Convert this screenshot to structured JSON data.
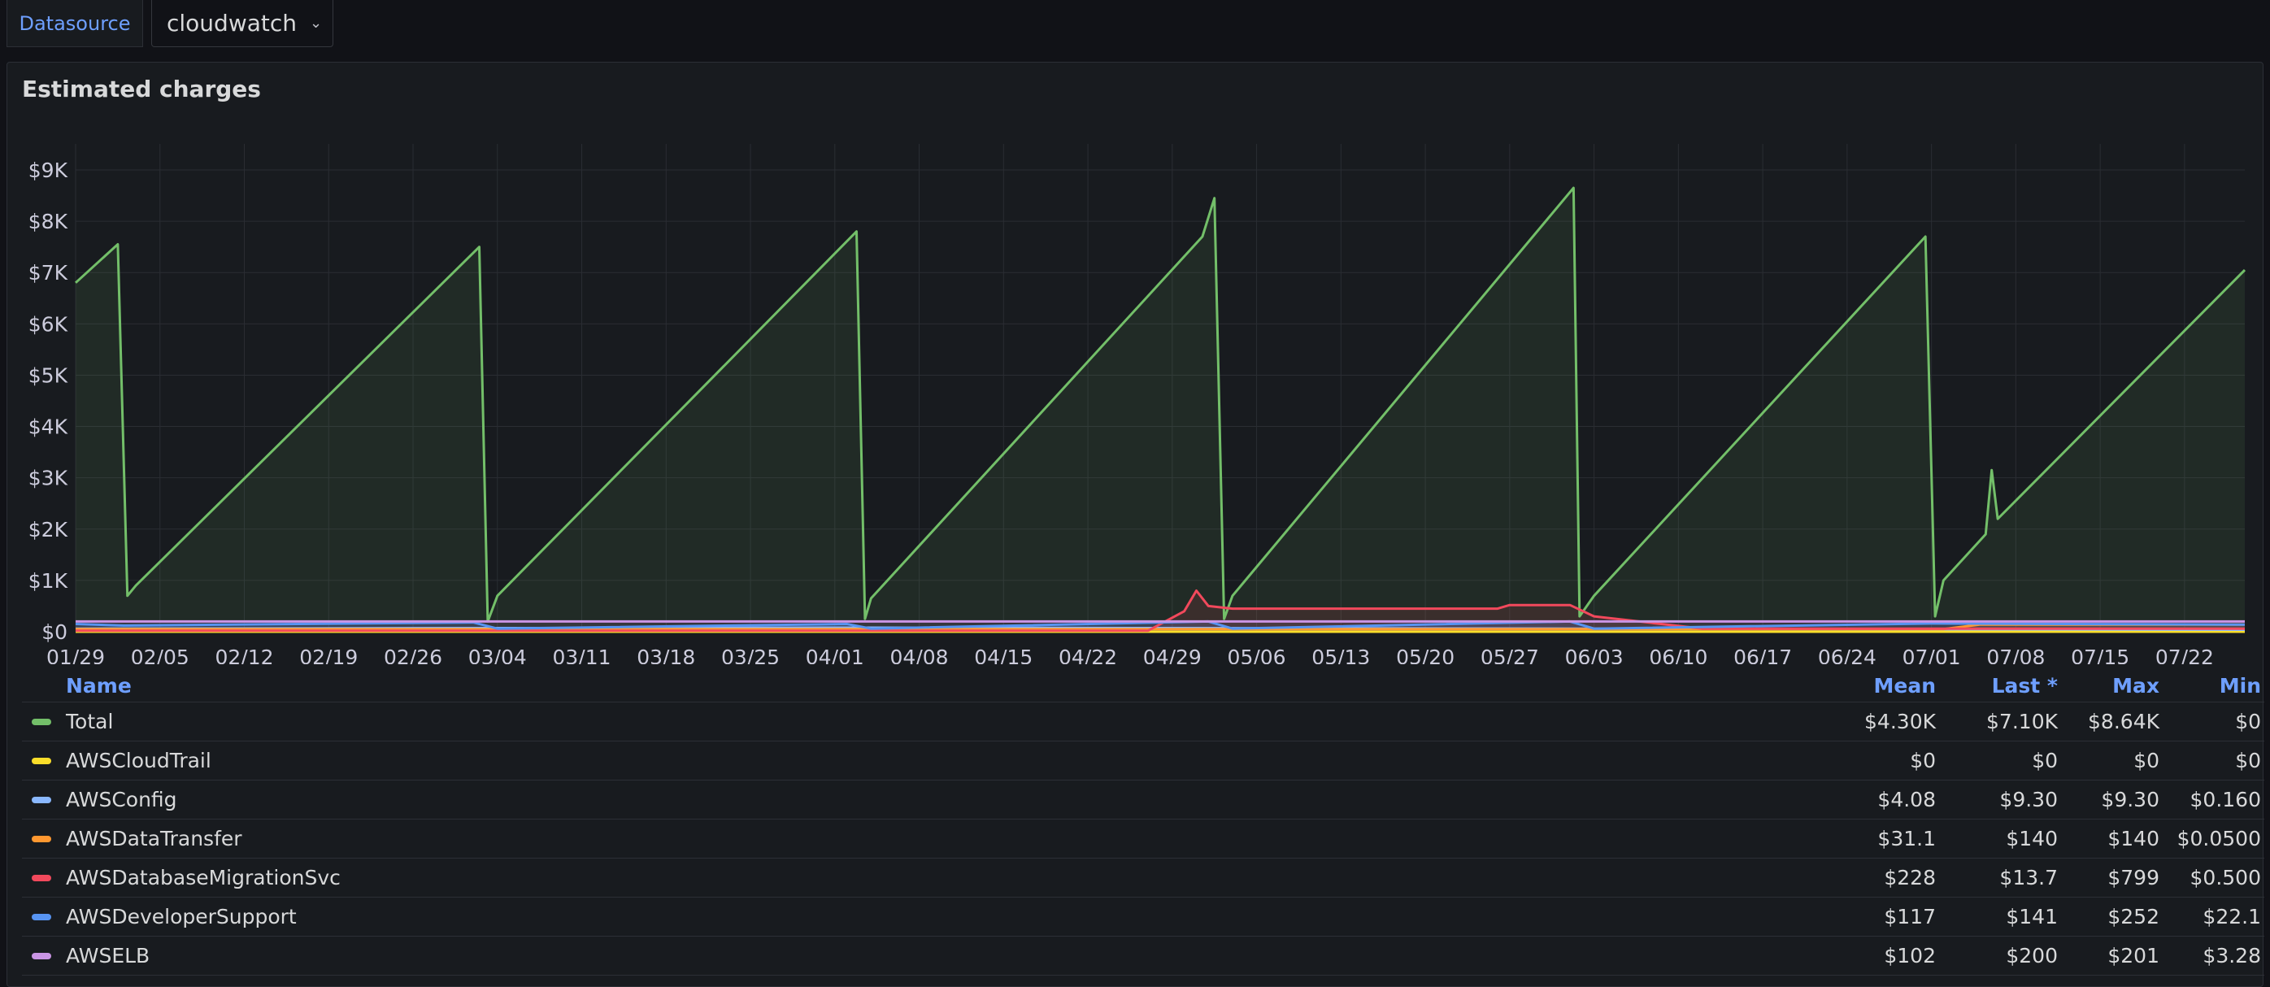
{
  "toolbar": {
    "datasource_label": "Datasource",
    "datasource_value": "cloudwatch"
  },
  "panel": {
    "title": "Estimated charges"
  },
  "chart_data": {
    "type": "area",
    "title": "Estimated charges",
    "ylim": [
      0,
      9500
    ],
    "y_ticks": [
      "$0",
      "$1K",
      "$2K",
      "$3K",
      "$4K",
      "$5K",
      "$6K",
      "$7K",
      "$8K",
      "$9K"
    ],
    "x_ticks": [
      "01/29",
      "02/05",
      "02/12",
      "02/19",
      "02/26",
      "03/04",
      "03/11",
      "03/18",
      "03/25",
      "04/01",
      "04/08",
      "04/15",
      "04/22",
      "04/29",
      "05/06",
      "05/13",
      "05/20",
      "05/27",
      "06/03",
      "06/10",
      "06/17",
      "06/24",
      "07/01",
      "07/08",
      "07/15",
      "07/22"
    ],
    "x_range_days": [
      0,
      180
    ],
    "grid": true,
    "legend_placement": "bottom",
    "series": [
      {
        "name": "Total",
        "color": "#73bf69",
        "points": [
          [
            0,
            6800
          ],
          [
            3.5,
            7550
          ],
          [
            4.3,
            700
          ],
          [
            5,
            900
          ],
          [
            33.5,
            7500
          ],
          [
            34.2,
            200
          ],
          [
            35,
            700
          ],
          [
            64.8,
            7800
          ],
          [
            65.5,
            250
          ],
          [
            66,
            650
          ],
          [
            93.5,
            7700
          ],
          [
            94.5,
            8450
          ],
          [
            95.3,
            250
          ],
          [
            96,
            700
          ],
          [
            124.3,
            8650
          ],
          [
            124.8,
            300
          ],
          [
            126,
            700
          ],
          [
            153.5,
            7700
          ],
          [
            154.3,
            300
          ],
          [
            155,
            1000
          ],
          [
            158.5,
            1900
          ],
          [
            159,
            3150
          ],
          [
            159.5,
            2200
          ],
          [
            180,
            7050
          ]
        ]
      },
      {
        "name": "AWSCloudTrail",
        "color": "#fade2a",
        "points": [
          [
            0,
            0
          ],
          [
            180,
            0
          ]
        ]
      },
      {
        "name": "AWSConfig",
        "color": "#8ab8ff",
        "points": [
          [
            0,
            60
          ],
          [
            65,
            80
          ],
          [
            125,
            60
          ],
          [
            180,
            40
          ]
        ]
      },
      {
        "name": "AWSDataTransfer",
        "color": "#ff9830",
        "points": [
          [
            0,
            50
          ],
          [
            155,
            50
          ],
          [
            158,
            140
          ],
          [
            180,
            140
          ]
        ]
      },
      {
        "name": "AWSDatabaseMigrationSvc",
        "color": "#f2495c",
        "points": [
          [
            0,
            20
          ],
          [
            89,
            20
          ],
          [
            92,
            400
          ],
          [
            93,
            800
          ],
          [
            94,
            500
          ],
          [
            96,
            450
          ],
          [
            118,
            450
          ],
          [
            119,
            520
          ],
          [
            124,
            520
          ],
          [
            126,
            300
          ],
          [
            135,
            60
          ],
          [
            180,
            60
          ]
        ]
      },
      {
        "name": "AWSDeveloperSupport",
        "color": "#5794f2",
        "points": [
          [
            0,
            150
          ],
          [
            4,
            120
          ],
          [
            33,
            180
          ],
          [
            35,
            60
          ],
          [
            64,
            150
          ],
          [
            66,
            60
          ],
          [
            94,
            200
          ],
          [
            96,
            60
          ],
          [
            124,
            200
          ],
          [
            126,
            60
          ],
          [
            154,
            160
          ],
          [
            180,
            140
          ]
        ]
      },
      {
        "name": "AWSELB",
        "color": "#ca95e5",
        "points": [
          [
            0,
            200
          ],
          [
            180,
            200
          ]
        ]
      }
    ]
  },
  "legend": {
    "headers": {
      "name": "Name",
      "mean": "Mean",
      "last": "Last *",
      "max": "Max",
      "min": "Min"
    },
    "rows": [
      {
        "name": "Total",
        "color": "#73bf69",
        "mean": "$4.30K",
        "last": "$7.10K",
        "max": "$8.64K",
        "min": "$0"
      },
      {
        "name": "AWSCloudTrail",
        "color": "#fade2a",
        "mean": "$0",
        "last": "$0",
        "max": "$0",
        "min": "$0"
      },
      {
        "name": "AWSConfig",
        "color": "#8ab8ff",
        "mean": "$4.08",
        "last": "$9.30",
        "max": "$9.30",
        "min": "$0.160"
      },
      {
        "name": "AWSDataTransfer",
        "color": "#ff9830",
        "mean": "$31.1",
        "last": "$140",
        "max": "$140",
        "min": "$0.0500"
      },
      {
        "name": "AWSDatabaseMigrationSvc",
        "color": "#f2495c",
        "mean": "$228",
        "last": "$13.7",
        "max": "$799",
        "min": "$0.500"
      },
      {
        "name": "AWSDeveloperSupport",
        "color": "#5794f2",
        "mean": "$117",
        "last": "$141",
        "max": "$252",
        "min": "$22.1"
      },
      {
        "name": "AWSELB",
        "color": "#ca95e5",
        "mean": "$102",
        "last": "$200",
        "max": "$201",
        "min": "$3.28"
      }
    ]
  }
}
